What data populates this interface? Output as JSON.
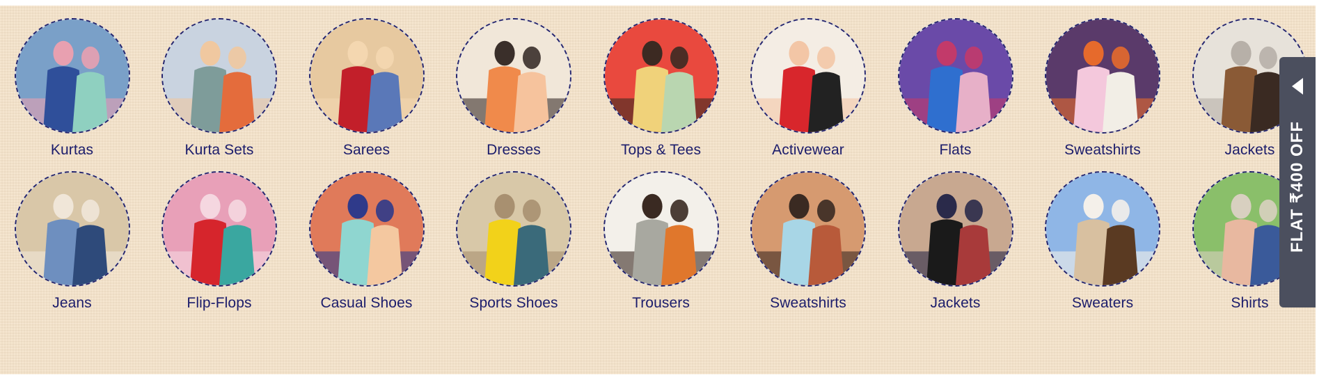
{
  "categories_row1": [
    {
      "label": "Kurtas",
      "icon": "kurtas-thumbnail",
      "colors": [
        "#7aa0c8",
        "#2f4f9a",
        "#8fd0c0",
        "#e8a0b0"
      ]
    },
    {
      "label": "Kurta Sets",
      "icon": "kurta-sets-thumbnail",
      "colors": [
        "#c9d3e0",
        "#7e9c9a",
        "#e46c3c",
        "#f0c8a0"
      ]
    },
    {
      "label": "Sarees",
      "icon": "sarees-thumbnail",
      "colors": [
        "#e7c9a0",
        "#c21f2a",
        "#5a78b8",
        "#f4d7b0"
      ]
    },
    {
      "label": "Dresses",
      "icon": "dresses-thumbnail",
      "colors": [
        "#f1e7d9",
        "#f08a4b",
        "#f6c39d",
        "#3a2f2a"
      ]
    },
    {
      "label": "Tops & Tees",
      "icon": "tops-tees-thumbnail",
      "colors": [
        "#e9493e",
        "#f0d27a",
        "#b9d6b0",
        "#3c2a22"
      ]
    },
    {
      "label": "Activewear",
      "icon": "activewear-thumbnail",
      "colors": [
        "#f4ede4",
        "#d8262c",
        "#222222",
        "#f3c6a6"
      ]
    },
    {
      "label": "Flats",
      "icon": "flats-thumbnail",
      "colors": [
        "#6a4aa8",
        "#2f6fcf",
        "#e7b0c8",
        "#c23a6a"
      ]
    },
    {
      "label": "Sweatshirts",
      "icon": "sweatshirts-thumbnail",
      "colors": [
        "#5a3a6a",
        "#f4c8dc",
        "#f2eee6",
        "#e66a2c"
      ]
    },
    {
      "label": "Jackets",
      "icon": "jackets-thumbnail",
      "colors": [
        "#e7e2da",
        "#8a5a36",
        "#3a2a22",
        "#b7b0a8"
      ]
    }
  ],
  "categories_row2": [
    {
      "label": "Jeans",
      "icon": "jeans-thumbnail",
      "colors": [
        "#d9c7a8",
        "#6e8fbf",
        "#2e4a7a",
        "#f0e6d8"
      ]
    },
    {
      "label": "Flip-Flops",
      "icon": "flip-flops-thumbnail",
      "colors": [
        "#e8a0b8",
        "#d6252c",
        "#3aa7a0",
        "#f5d7e0"
      ]
    },
    {
      "label": "Casual Shoes",
      "icon": "casual-shoes-thumbnail",
      "colors": [
        "#e07a5a",
        "#8fd6d0",
        "#f4c8a0",
        "#2f3a8a"
      ]
    },
    {
      "label": "Sports Shoes",
      "icon": "sports-shoes-thumbnail",
      "colors": [
        "#d8c8a8",
        "#f2d21a",
        "#3a6a7a",
        "#a89070"
      ]
    },
    {
      "label": "Trousers",
      "icon": "trousers-thumbnail",
      "colors": [
        "#f3f0ea",
        "#a8a8a0",
        "#e0772c",
        "#3a2a22"
      ]
    },
    {
      "label": "Sweatshirts",
      "icon": "sweatshirts-men-thumbnail",
      "colors": [
        "#d69a70",
        "#a8d6e6",
        "#b85a3a",
        "#3a2a22"
      ]
    },
    {
      "label": "Jackets",
      "icon": "jackets-men-thumbnail",
      "colors": [
        "#c8a890",
        "#1a1a1a",
        "#a83a3a",
        "#2a2a4a"
      ]
    },
    {
      "label": "Sweaters",
      "icon": "sweaters-thumbnail",
      "colors": [
        "#8fb6e6",
        "#d8c0a0",
        "#5a3a22",
        "#f4f0ea"
      ]
    },
    {
      "label": "Shirts",
      "icon": "shirts-thumbnail",
      "colors": [
        "#8abf6a",
        "#e8b8a0",
        "#3a5a9a",
        "#d8d0c0"
      ]
    }
  ],
  "offer": {
    "label": "FLAT ₹400 OFF",
    "icon": "chevron-left-icon",
    "bg": "#4b4f5e"
  },
  "theme": {
    "panel_bg": "#f4e2c9",
    "label_color": "#1b1c6b",
    "ring_color": "#23246f"
  }
}
